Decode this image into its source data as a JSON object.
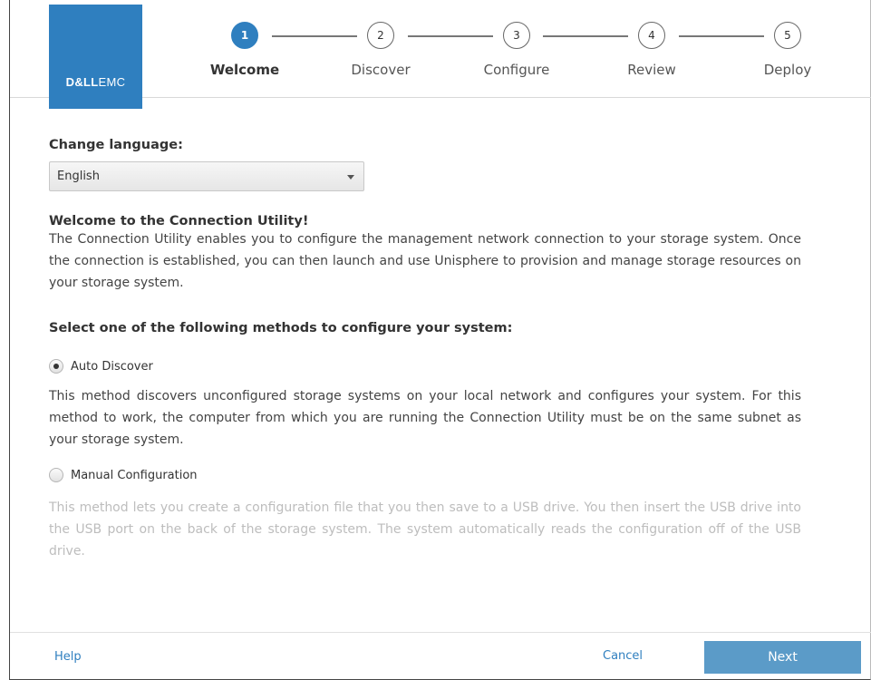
{
  "brand": {
    "logo_dell": "D&LL",
    "logo_emc": "EMC",
    "color": "#2f7fbf"
  },
  "steps": [
    {
      "number": "1",
      "label": "Welcome",
      "active": true
    },
    {
      "number": "2",
      "label": "Discover",
      "active": false
    },
    {
      "number": "3",
      "label": "Configure",
      "active": false
    },
    {
      "number": "4",
      "label": "Review",
      "active": false
    },
    {
      "number": "5",
      "label": "Deploy",
      "active": false
    }
  ],
  "language": {
    "label": "Change language:",
    "selected": "English"
  },
  "welcome": {
    "title": "Welcome to the Connection Utility!",
    "body": "The Connection Utility enables you to configure the management network connection to your storage system. Once the connection is established, you can then launch and use Unisphere to provision and manage storage resources on your storage system."
  },
  "methods": {
    "heading": "Select one of the following methods to configure your system:",
    "auto": {
      "label": "Auto Discover",
      "selected": true,
      "description": "This method discovers unconfigured storage systems on your local network and configures your system. For this method to work, the computer from which you are running the Connection Utility must be on the same subnet as your storage system."
    },
    "manual": {
      "label": "Manual Configuration",
      "selected": false,
      "description": "This method lets you create a configuration file that you then save to a USB drive. You then insert the USB drive into the USB port on the back of the storage system.  The system automatically reads the configuration off of the USB drive."
    }
  },
  "footer": {
    "help": "Help",
    "cancel": "Cancel",
    "next": "Next"
  }
}
